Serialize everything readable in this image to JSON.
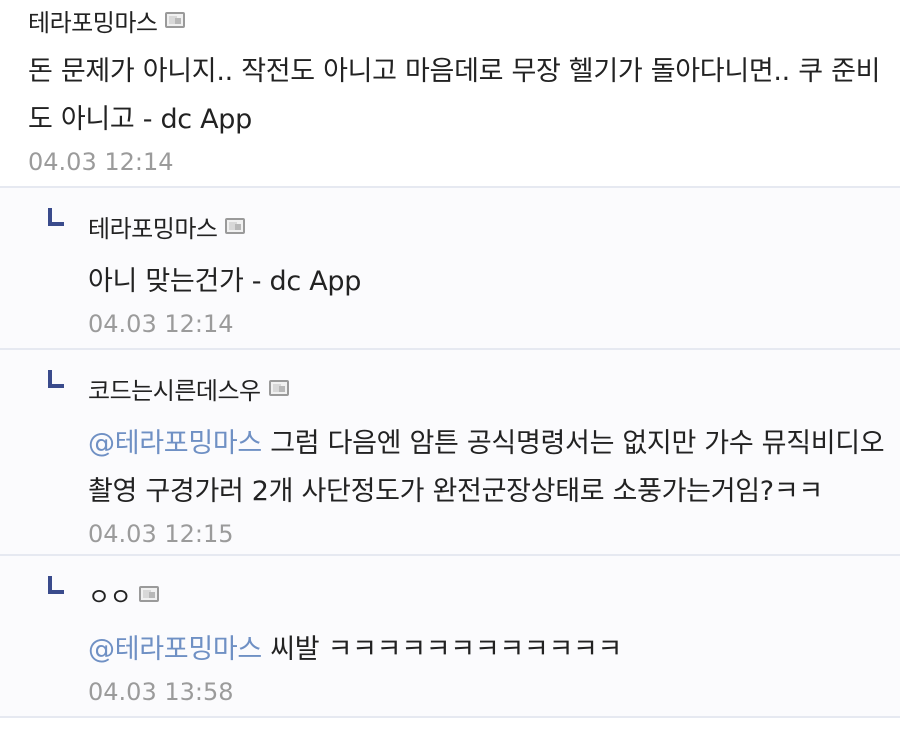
{
  "thread": {
    "main_comment": {
      "nickname": "테라포밍마스",
      "text": "돈 문제가 아니지.. 작전도 아니고 마음데로 무장 헬기가 돌아다니면.. 쿠 준비도 아니고 - dc App",
      "time": "04.03 12:14"
    },
    "replies": [
      {
        "nickname": "테라포밍마스",
        "mention": "",
        "text": "아니 맞는건가 - dc App",
        "time": "04.03 12:14"
      },
      {
        "nickname": "코드는시른데스우",
        "mention": "@테라포밍마스",
        "text": " 그럼 다음엔 암튼 공식명령서는 없지만 가수 뮤직비디오 촬영 구경가러 2개 사단정도가 완전군장상태로 소풍가는거임?ㅋㅋ",
        "time": "04.03 12:15"
      },
      {
        "nickname": "ㅇㅇ",
        "mention": "@테라포밍마스",
        "text": " 씨발 ㅋㅋㅋㅋㅋㅋㅋㅋㅋㅋㅋㅋ",
        "time": "04.03 13:58"
      }
    ]
  },
  "icons": {
    "user_badge": "user-badge-icon",
    "reply_arrow": "reply-arrow-icon"
  },
  "colors": {
    "mention": "#6f90c4",
    "timestamp": "#9b9b9b",
    "reply_icon": "#3a4b8c",
    "divider": "#e6e9f1"
  }
}
